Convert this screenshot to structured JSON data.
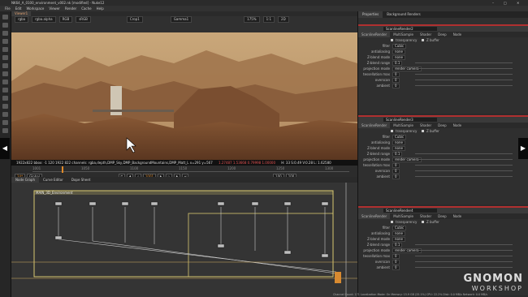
{
  "window": {
    "title": "NK64_A_0100_environment_v002.nk [modified] - Nuke12",
    "minimize": "–",
    "maximize": "□",
    "close": "✕"
  },
  "menu": [
    "File",
    "Edit",
    "Workspace",
    "Viewer",
    "Render",
    "Cache",
    "Help"
  ],
  "viewer": {
    "tab": "Viewer1",
    "channels": "rgba",
    "layer": "rgba.alpha",
    "colorspace": "RGB",
    "lut": "sRGB",
    "input_a": "Crop1",
    "input_b": "Gamma1",
    "zoom": "175%",
    "ratio": "1:1",
    "mode": "2D",
    "info_line": "1922x822   bbox: -1 120 1922 822 channels: rgba,depth,DMP_Sky,DMP_BackgroundMountains,DMP_Matt_L   x=291 y=567",
    "pixel_values": "1.27487  1.53668  0.79998  1.00000",
    "hsvl": "H: 33 S:0.49 V:0.28 L: 1.62580",
    "timeline_ticks": [
      "1001",
      "1050",
      "1100",
      "1150",
      "1200",
      "1250",
      "1300"
    ],
    "frame": "1001",
    "fps": "24*",
    "global_label": "Global",
    "frame_end": "100",
    "frame_count": "100"
  },
  "nodegraph": {
    "tabs": [
      "Node Graph",
      "Curve Editor",
      "Dope Sheet"
    ],
    "backdrop_label": "MAIN_3D_Environment"
  },
  "properties": {
    "tabs": [
      "Properties",
      "Background Renders"
    ],
    "panels": [
      {
        "name": "ScanlineRender2",
        "subtabs": [
          "ScanlineRender",
          "MultiSample",
          "Shader",
          "Deep",
          "Node"
        ],
        "rows": [
          [
            "transparency",
            "Z buffer"
          ],
          [
            "filter",
            "Cubic"
          ],
          [
            "antialiasing",
            "none"
          ],
          [
            "Z-blend mode",
            "none"
          ],
          [
            "Z-blend range",
            "0.1"
          ],
          [
            "projection mode",
            "render camera"
          ],
          [
            "tessellation max",
            "0"
          ],
          [
            "overscan",
            "0"
          ],
          [
            "ambient",
            "0"
          ]
        ]
      },
      {
        "name": "ScanlineRender3",
        "subtabs": [
          "ScanlineRender",
          "MultiSample",
          "Shader",
          "Deep",
          "Node"
        ],
        "rows": [
          [
            "transparency",
            "Z buffer"
          ],
          [
            "filter",
            "Cubic"
          ],
          [
            "antialiasing",
            "none"
          ],
          [
            "Z-blend mode",
            "none"
          ],
          [
            "Z-blend range",
            "0.1"
          ],
          [
            "projection mode",
            "render camera"
          ],
          [
            "tessellation max",
            "0"
          ],
          [
            "overscan",
            "0"
          ],
          [
            "ambient",
            "0"
          ]
        ]
      },
      {
        "name": "ScanlineRender4",
        "subtabs": [
          "ScanlineRender",
          "MultiSample",
          "Shader",
          "Deep",
          "Node"
        ],
        "rows": [
          [
            "transparency",
            "Z buffer"
          ],
          [
            "filter",
            "Cubic"
          ],
          [
            "antialiasing",
            "none"
          ],
          [
            "Z-blend mode",
            "none"
          ],
          [
            "Z-blend range",
            "0.1"
          ],
          [
            "projection mode",
            "render camera"
          ],
          [
            "tessellation max",
            "0"
          ],
          [
            "overscan",
            "0"
          ],
          [
            "ambient",
            "0"
          ]
        ]
      }
    ]
  },
  "status": "Channel Count: 171  Localization Mode: On  Memory: 15.9 GB (25.1%)  CPU: 22.2%  Disk: 0.0 MB/s  Network: 0.0 MB/s",
  "watermark": {
    "line1": "GNOMON",
    "line2": "WORKSHOP"
  },
  "colors": {
    "accent": "#e08a2a",
    "panel_border": "#b03030",
    "backdrop": "#d8c870"
  }
}
